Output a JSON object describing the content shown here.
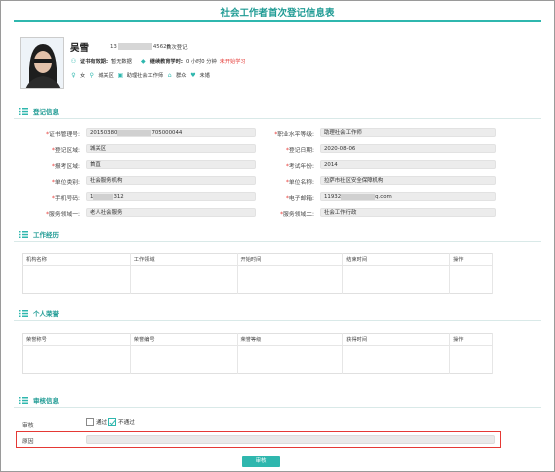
{
  "header": {
    "title": "社会工作者首次登记信息表"
  },
  "profile": {
    "name": "吴雪",
    "id_prefix": "13",
    "id_suffix": "45626",
    "first_reg": "首次登记",
    "cert_label": "证书有效期:",
    "cert_value": "暂无数据",
    "edu_label": "继续教育学时:",
    "edu_value": "0 小时0 分钟",
    "edu_status": "未开始学习",
    "gender": "女",
    "area": "城关区",
    "level": "助理社会工作师",
    "status": "群众",
    "marital": "未婚"
  },
  "sections": {
    "basic": "登记信息",
    "work": "工作经历",
    "honor": "个人荣誉",
    "audit": "审核信息"
  },
  "basic_left": [
    {
      "label": "证书管理号:",
      "required": true,
      "value_prefix": "20150380",
      "value_suffix": "705000044"
    },
    {
      "label": "登记区域:",
      "required": true,
      "value": "城关区"
    },
    {
      "label": "报考区域:",
      "required": true,
      "value": "首直"
    },
    {
      "label": "单位类别:",
      "required": true,
      "value": "社会服务机构"
    },
    {
      "label": "手机号码:",
      "required": true,
      "value_prefix": "1",
      "value_suffix": "312"
    },
    {
      "label": "服务领域一:",
      "required": true,
      "value": "老人社会服务"
    }
  ],
  "basic_right": [
    {
      "label": "职业水平等级:",
      "required": true,
      "value": "助理社会工作师"
    },
    {
      "label": "登记日期:",
      "required": true,
      "value": "2020-08-06"
    },
    {
      "label": "考试年份:",
      "required": true,
      "value": "2014"
    },
    {
      "label": "单位名称:",
      "required": true,
      "value": "拉萨市社区安全保障机构"
    },
    {
      "label": "电子邮箱:",
      "required": true,
      "value_prefix": "11932",
      "value_suffix": "q.com"
    },
    {
      "label": "服务领域二:",
      "required": true,
      "value": "社会工作行政"
    }
  ],
  "work_table": {
    "columns": [
      "机构名称",
      "工作领域",
      "开始时间",
      "结束时间",
      "操作"
    ]
  },
  "honor_table": {
    "columns": [
      "荣誉称号",
      "荣誉编号",
      "荣誉等级",
      "获得时间",
      "操作"
    ]
  },
  "audit": {
    "label": "审核",
    "pass": "通过",
    "reject": "不通过",
    "selected": "不通过",
    "reason_label": "原因",
    "reason_value": ""
  },
  "submit": {
    "label": "审核"
  }
}
